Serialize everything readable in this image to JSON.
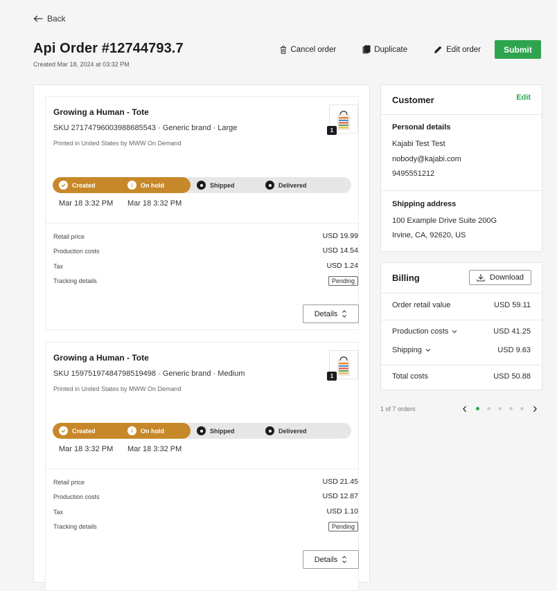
{
  "header": {
    "back_label": "Back",
    "title": "Api Order #12744793.7",
    "created": "Created Mar 18, 2024 at 03:32 PM"
  },
  "actions": {
    "cancel": "Cancel order",
    "duplicate": "Duplicate",
    "edit": "Edit order",
    "submit": "Submit"
  },
  "colors": {
    "accent_green": "#2ea44f",
    "progress_done": "#c7882a",
    "progress_track": "#e6e6e6"
  },
  "items": [
    {
      "name": "Growing a Human - Tote",
      "sku": "SKU 27174796003988685543  · Generic brand · Large",
      "printed": "Printed in United States by MWW On Demand",
      "quantity": "1",
      "steps": [
        {
          "label": "Created",
          "state": "done",
          "icon": "check-icon"
        },
        {
          "label": "On hold",
          "state": "done",
          "icon": "info-icon"
        },
        {
          "label": "Shipped",
          "state": "pending",
          "icon": "dot-icon"
        },
        {
          "label": "Delivered",
          "state": "pending",
          "icon": "dot-icon"
        }
      ],
      "step_times": [
        "Mar 18 3:32 PM",
        "Mar 18 3:32 PM"
      ],
      "retail_label": "Retail price",
      "retail": "USD 19.99",
      "production_label": "Production costs",
      "production": "USD 14.54",
      "tax_label": "Tax",
      "tax": "USD 1.24",
      "tracking_label": "Tracking details",
      "tracking_status": "Pending",
      "details_label": "Details"
    },
    {
      "name": "Growing a Human - Tote",
      "sku": "SKU 15975197484798519498  · Generic brand · Medium",
      "printed": "Printed in United States by MWW On Demand",
      "quantity": "1",
      "steps": [
        {
          "label": "Created",
          "state": "done",
          "icon": "check-icon"
        },
        {
          "label": "On hold",
          "state": "done",
          "icon": "info-icon"
        },
        {
          "label": "Shipped",
          "state": "pending",
          "icon": "dot-icon"
        },
        {
          "label": "Delivered",
          "state": "pending",
          "icon": "dot-icon"
        }
      ],
      "step_times": [
        "Mar 18 3:32 PM",
        "Mar 18 3:32 PM"
      ],
      "retail_label": "Retail price",
      "retail": "USD 21.45",
      "production_label": "Production costs",
      "production": "USD 12.87",
      "tax_label": "Tax",
      "tax": "USD 1.10",
      "tracking_label": "Tracking details",
      "tracking_status": "Pending",
      "details_label": "Details"
    }
  ],
  "customer": {
    "title": "Customer",
    "edit_label": "Edit",
    "personal_label": "Personal details",
    "name": "Kajabi Test Test",
    "email": "nobody@kajabi.com",
    "phone": "9495551212",
    "shipping_label": "Shipping address",
    "address_line1": "100 Example Drive Suite 200G",
    "address_line2": "Irvine, CA, 92620, US"
  },
  "billing": {
    "title": "Billing",
    "download_label": "Download",
    "retail_label": "Order retail value",
    "retail_value": "USD 59.11",
    "production_label": "Production costs",
    "production_value": "USD 41.25",
    "shipping_label": "Shipping",
    "shipping_value": "USD 9.63",
    "total_label": "Total costs",
    "total_value": "USD 50.88"
  },
  "pagination": {
    "info": "1 of 7 orders",
    "page_count": 5,
    "active_page": 1
  }
}
